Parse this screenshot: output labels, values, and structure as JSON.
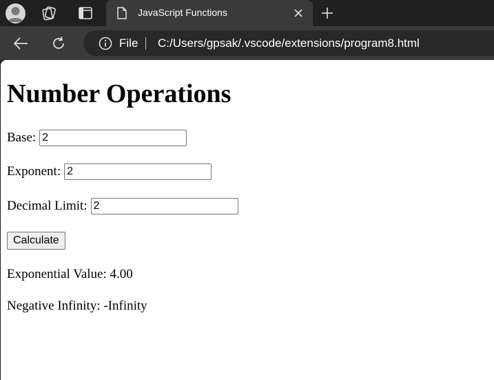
{
  "browser": {
    "tab": {
      "title": "JavaScript Functions"
    },
    "address": {
      "scheme_label": "File",
      "url": "C:/Users/gpsak/.vscode/extensions/program8.html"
    },
    "icons": [
      "avatar",
      "workspaces-icon",
      "vertical-tabs-icon",
      "page-icon",
      "close-icon",
      "new-tab-icon",
      "back-icon",
      "reload-icon",
      "info-icon"
    ]
  },
  "page": {
    "heading": "Number Operations",
    "fields": [
      {
        "label": "Base:",
        "value": "2"
      },
      {
        "label": "Exponent:",
        "value": "2"
      },
      {
        "label": "Decimal Limit:",
        "value": "2"
      }
    ],
    "button_label": "Calculate",
    "results": [
      "Exponential Value: 4.00",
      "Negative Infinity: -Infinity"
    ]
  }
}
